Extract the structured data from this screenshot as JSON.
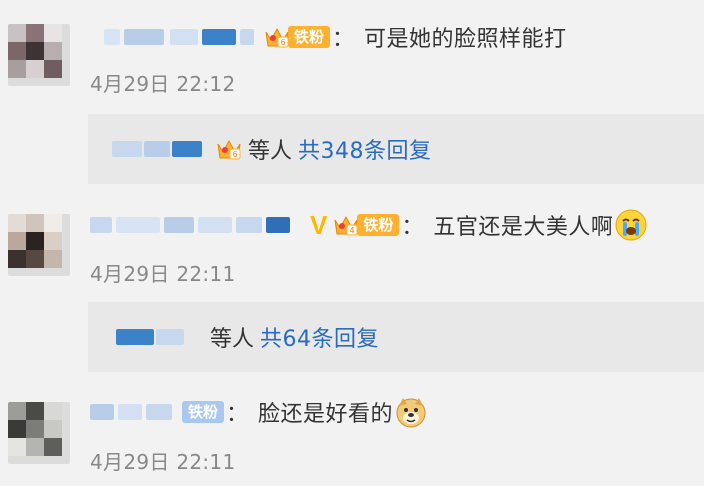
{
  "comments": [
    {
      "text": "可是她的脸照样能打",
      "time": "4月29日 22:12",
      "fan_badge": "铁粉",
      "fan_level": "6",
      "reply": {
        "suffix": "等人",
        "count": "共348条回复",
        "badge_level": "6"
      }
    },
    {
      "text": "五官还是大美人啊",
      "time": "4月29日 22:11",
      "fan_badge": "铁粉",
      "fan_level": "4",
      "verified": "V",
      "emoji": "crying-face-emoji",
      "reply": {
        "suffix": "等人",
        "count": "共64条回复"
      }
    },
    {
      "text": "脸还是好看的",
      "time": "4月29日 22:11",
      "fan_badge": "铁粉",
      "emoji": "doge-emoji"
    }
  ],
  "colors": {
    "link": "#2a6bbf",
    "fan_gold": "#ffb02e",
    "fan_blue": "#a8c8f0",
    "time": "#888888",
    "reply_bg": "#e8e8e8"
  },
  "separator": "："
}
